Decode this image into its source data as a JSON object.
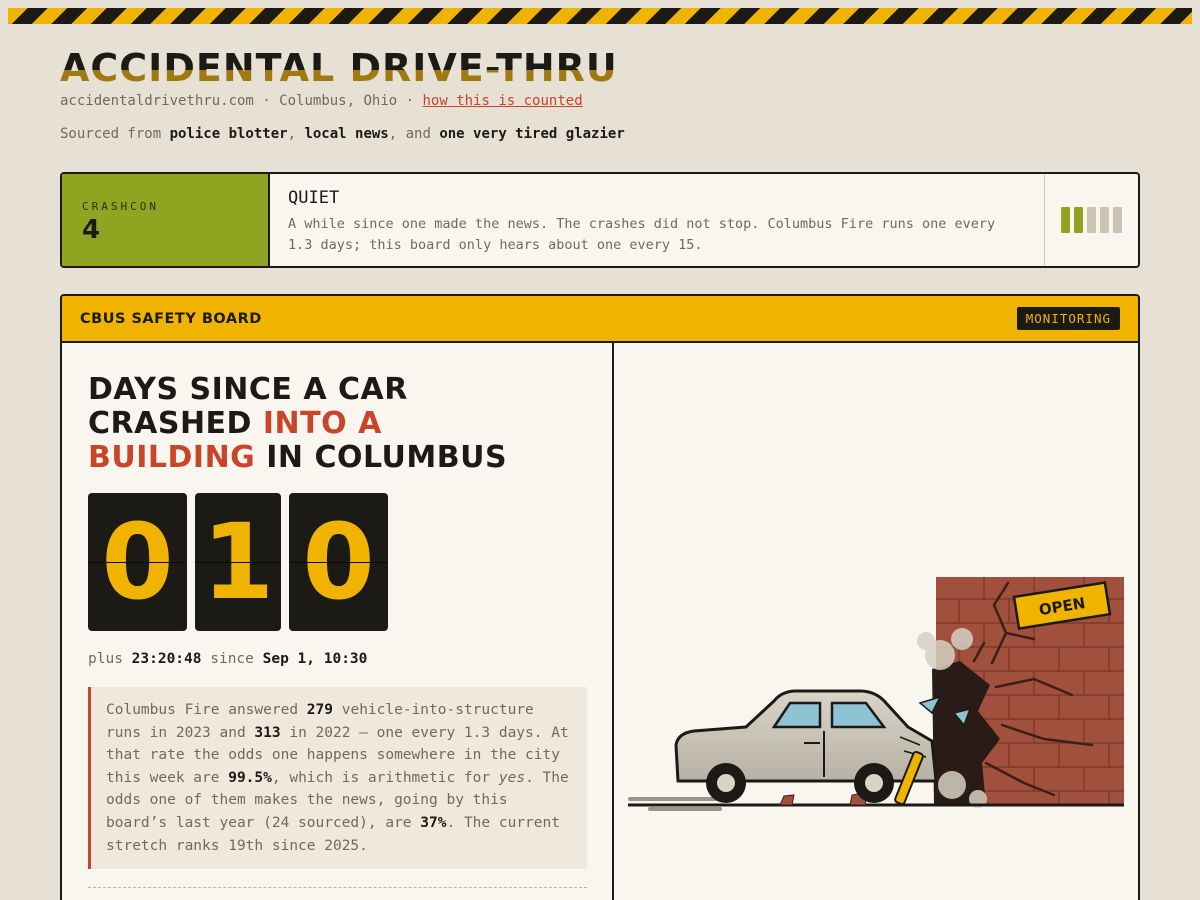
{
  "site": {
    "title": "ACCIDENTAL DRIVE-THRU",
    "domain": "accidentaldrivethru.com",
    "sep1": " · ",
    "city": "Columbus, Ohio",
    "sep2": " · ",
    "method_link": "how this is counted",
    "sources": {
      "prefix": "Sourced from ",
      "s1": "police blotter",
      "c1": ", ",
      "s2": "local news",
      "c2": ", and ",
      "s3": "one very tired glazier"
    }
  },
  "crashcon": {
    "label": "CRASHCON",
    "level": "4",
    "state": "QUIET",
    "description": "A while since one made the news. The crashes did not stop. Columbus Fire runs one every 1.3 days; this board only hears about one every 15.",
    "bars_lit": 2,
    "bars_total": 5,
    "color": "#8fa421"
  },
  "board": {
    "title": "CBUS SAFETY BOARD",
    "status": "MONITORING",
    "headline": {
      "part1": "Days since a car crashed ",
      "highlight": "into a building",
      "part2": " in Columbus"
    },
    "counter_digits": [
      "0",
      "1",
      "0"
    ],
    "since": {
      "plus_label": "plus",
      "elapsed": "23:20:48",
      "since_label": "since",
      "date": "Sep 1, 10:30"
    },
    "note": {
      "t1": "Columbus Fire answered ",
      "n1": "279",
      "t2": " vehicle-into-structure runs in 2023 and ",
      "n2": "313",
      "t3": " in 2022 — one every 1.3 days. At that rate the odds one happens somewhere in the city this week are ",
      "n3": "99.5%",
      "t4": ", which is arithmetic for ",
      "em": "yes",
      "t5": ". The odds one of them makes the news, going by this board’s last year (24 sourced), are ",
      "n4": "37%",
      "t6": ". The current stretch ranks 19th since 2025."
    },
    "illustration": {
      "sign_text": "OPEN"
    }
  },
  "colors": {
    "accent_yellow": "#f0b400",
    "accent_red": "#c8452a",
    "background": "#e6e0d5",
    "ink": "#1c1a15"
  }
}
